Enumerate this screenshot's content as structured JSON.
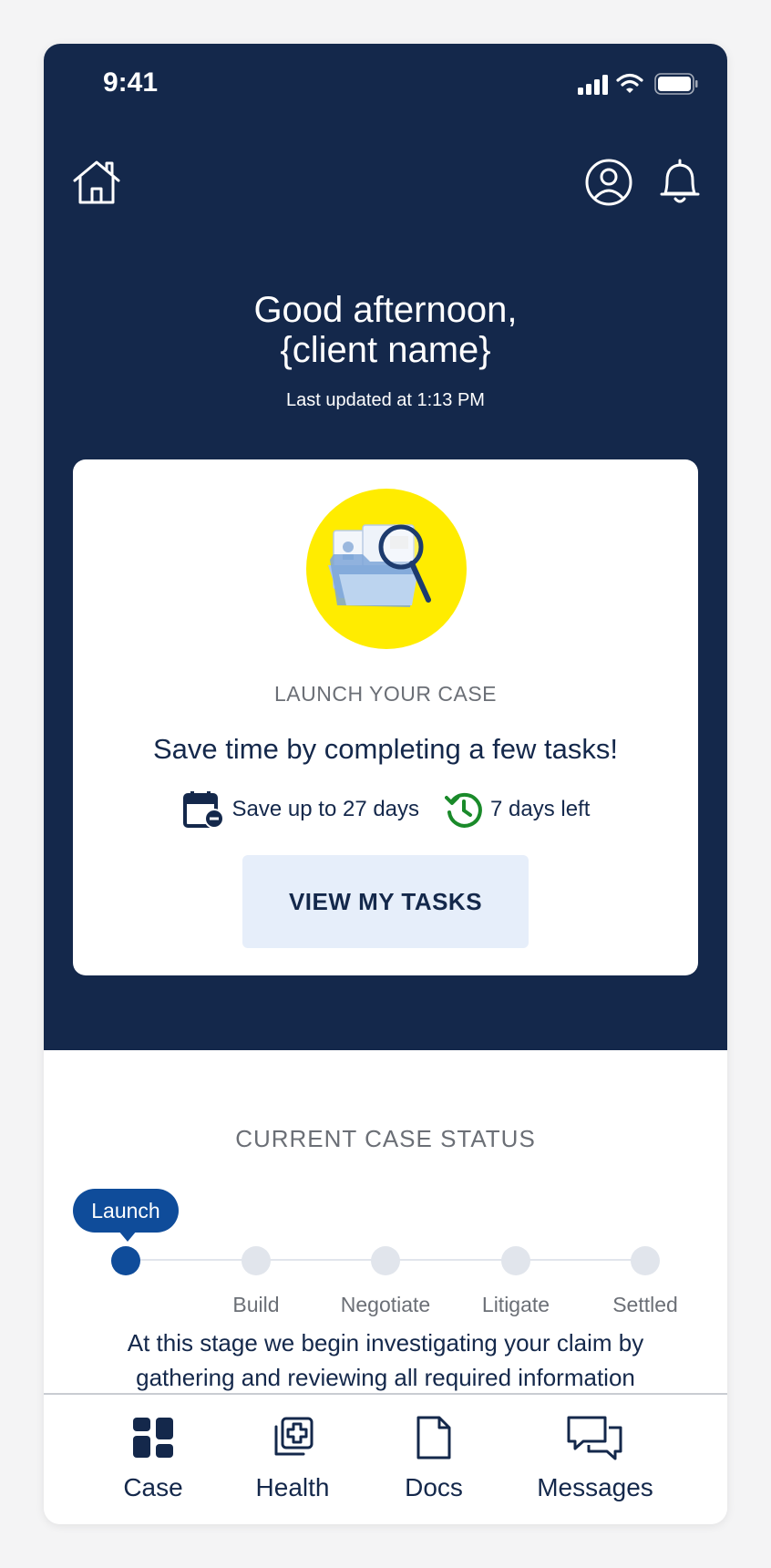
{
  "status_bar": {
    "time": "9:41"
  },
  "topnav": {
    "home_icon": "home-icon",
    "profile_icon": "user-circle-icon",
    "notifications_icon": "bell-icon"
  },
  "greeting": {
    "line1": "Good afternoon,",
    "line2": "{client name}",
    "last_updated": "Last updated at 1:13 PM"
  },
  "task_card": {
    "illustration": "folder-magnifier-illustration",
    "eyebrow": "LAUNCH YOUR CASE",
    "title": "Save time by completing a few tasks!",
    "save_label": "Save up to 27 days",
    "days_left_label": "7 days left",
    "cta_label": "VIEW MY TASKS"
  },
  "case_status": {
    "heading": "CURRENT CASE STATUS",
    "current_stage": "Launch",
    "stages": [
      "Launch",
      "Build",
      "Negotiate",
      "Litigate",
      "Settled"
    ],
    "description": "At this stage we begin investigating your claim by gathering and reviewing all required information"
  },
  "tabbar": {
    "tabs": [
      {
        "label": "Case",
        "icon": "case-dashboard-icon"
      },
      {
        "label": "Health",
        "icon": "health-plus-icon"
      },
      {
        "label": "Docs",
        "icon": "document-icon"
      },
      {
        "label": "Messages",
        "icon": "messages-icon"
      }
    ]
  },
  "colors": {
    "navy": "#14284b",
    "accent_blue": "#0f4c9a",
    "cta_bg": "#e6eefa",
    "illustration_yellow": "#ffec00",
    "timer_green": "#1a8a2a"
  }
}
